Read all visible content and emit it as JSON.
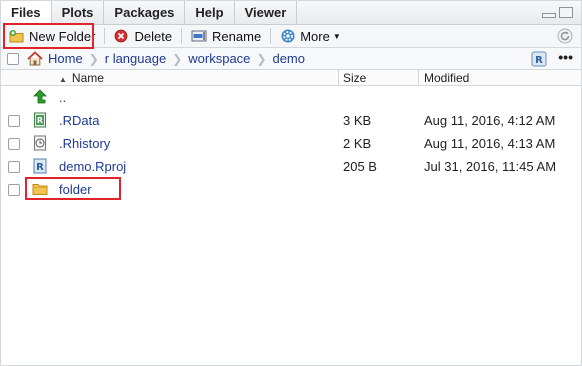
{
  "tabs": [
    {
      "label": "Files",
      "active": true
    },
    {
      "label": "Plots",
      "active": false
    },
    {
      "label": "Packages",
      "active": false
    },
    {
      "label": "Help",
      "active": false
    },
    {
      "label": "Viewer",
      "active": false
    }
  ],
  "toolbar": {
    "new_folder": "New Folder",
    "delete": "Delete",
    "rename": "Rename",
    "more": "More"
  },
  "breadcrumb": [
    "Home",
    "r language",
    "workspace",
    "demo"
  ],
  "columns": {
    "name": "Name",
    "size": "Size",
    "modified": "Modified"
  },
  "files": [
    {
      "name": "..",
      "size": "",
      "modified": "",
      "icon": "up-arrow-icon"
    },
    {
      "name": ".RData",
      "size": "3 KB",
      "modified": "Aug 11, 2016, 4:12 AM",
      "icon": "rdata-icon"
    },
    {
      "name": ".Rhistory",
      "size": "2 KB",
      "modified": "Aug 11, 2016, 4:13 AM",
      "icon": "rhistory-icon"
    },
    {
      "name": "demo.Rproj",
      "size": "205 B",
      "modified": "Jul 31, 2016, 11:45 AM",
      "icon": "rproj-icon"
    },
    {
      "name": "folder",
      "size": "",
      "modified": "",
      "icon": "folder-icon"
    }
  ],
  "colors": {
    "link": "#1f3a93",
    "highlight": "#e0242a"
  }
}
